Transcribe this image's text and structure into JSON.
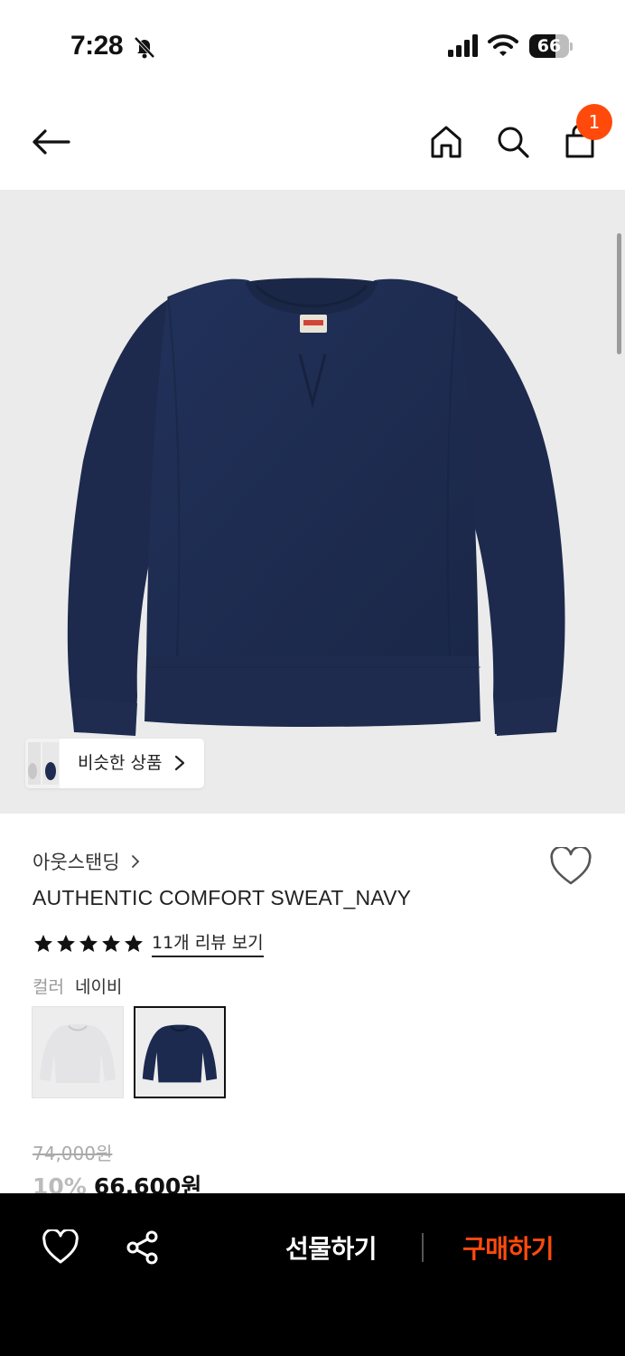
{
  "status_bar": {
    "time": "7:28",
    "battery_percent": 66,
    "battery_text": "66"
  },
  "header": {
    "cart_count": "1"
  },
  "hero": {
    "product_image": "navy-crewneck-sweatshirt",
    "similar_products_label": "비슷한 상품"
  },
  "product": {
    "brand": "아웃스탠딩",
    "title": "AUTHENTIC COMFORT SWEAT_NAVY",
    "rating_stars": 5,
    "review_link": "11개 리뷰 보기",
    "color_label": "컬러",
    "color_value": "네이비",
    "swatches": [
      {
        "color": "#e4e4e6",
        "selected": false
      },
      {
        "color": "#1c2a4f",
        "selected": true
      }
    ],
    "original_price": "74,000원",
    "discount": "10%",
    "final_price": "66,600원"
  },
  "bottom_bar": {
    "gift_label": "선물하기",
    "buy_label": "구매하기",
    "accent_color": "#ff4a0c"
  }
}
